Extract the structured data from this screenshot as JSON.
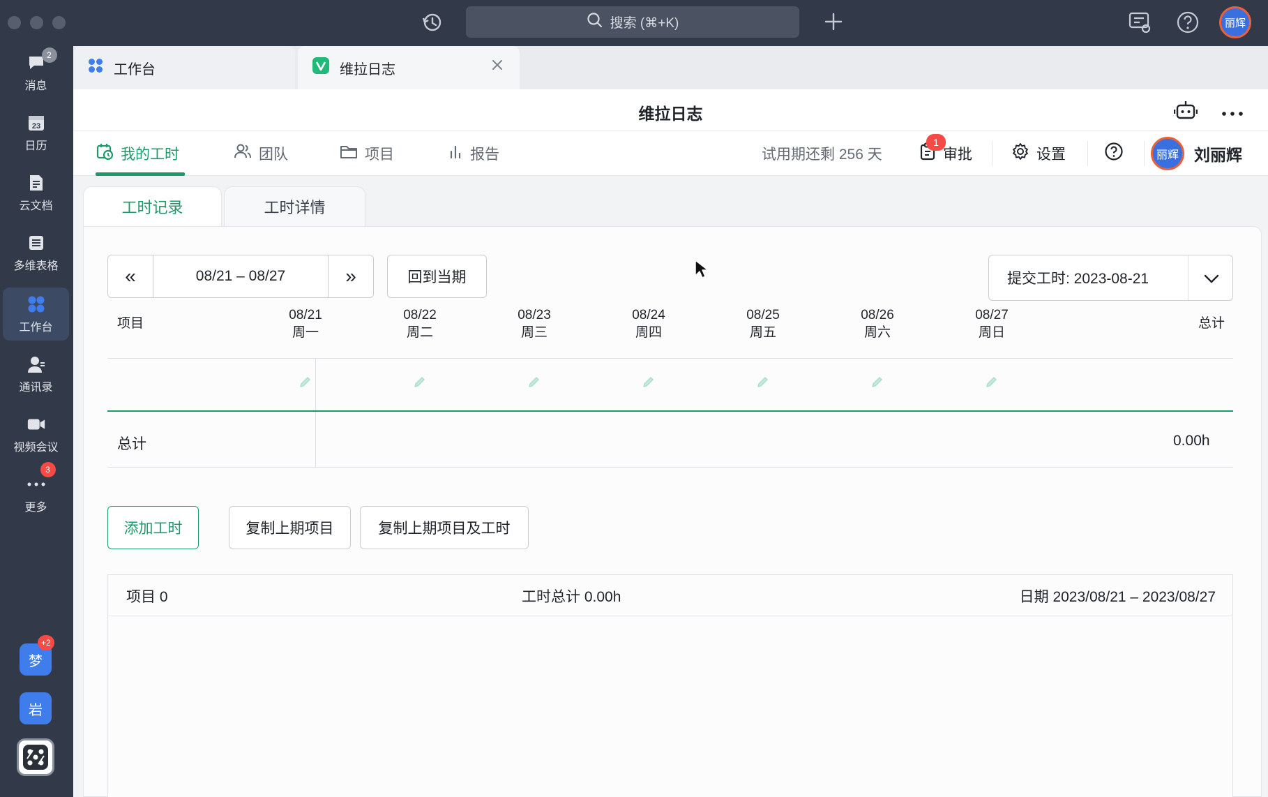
{
  "titlebar": {
    "search_label": "搜索 (⌘+K)",
    "avatar_text": "丽辉"
  },
  "sidebar": {
    "items": [
      {
        "label": "消息",
        "badge": "2"
      },
      {
        "label": "日历",
        "icon_text": "23"
      },
      {
        "label": "云文档"
      },
      {
        "label": "多维表格"
      },
      {
        "label": "工作台"
      },
      {
        "label": "通讯录"
      },
      {
        "label": "视频会议"
      },
      {
        "label": "更多",
        "badge": "3"
      }
    ],
    "shortcuts": [
      {
        "label": "梦",
        "badge": "+2"
      },
      {
        "label": "岩"
      }
    ]
  },
  "tabs": [
    {
      "label": "工作台"
    },
    {
      "label": "维拉日志"
    }
  ],
  "app": {
    "title": "维拉日志",
    "menu": {
      "my_hours": "我的工时",
      "team": "团队",
      "project": "项目",
      "report": "报告",
      "trial": "试用期还剩 256 天",
      "approval": "审批",
      "approval_badge": "1",
      "settings": "设置",
      "user_name": "刘丽辉",
      "user_avatar_text": "丽辉"
    },
    "subtabs": {
      "records": "工时记录",
      "details": "工时详情"
    },
    "date_nav": {
      "prev": "«",
      "range": "08/21 – 08/27",
      "next": "»",
      "back_current": "回到当期",
      "submit": "提交工时: 2023-08-21"
    },
    "table": {
      "project_col": "项目",
      "total_col": "总计",
      "days": [
        {
          "date": "08/21",
          "weekday": "周一"
        },
        {
          "date": "08/22",
          "weekday": "周二"
        },
        {
          "date": "08/23",
          "weekday": "周三"
        },
        {
          "date": "08/24",
          "weekday": "周四"
        },
        {
          "date": "08/25",
          "weekday": "周五"
        },
        {
          "date": "08/26",
          "weekday": "周六"
        },
        {
          "date": "08/27",
          "weekday": "周日"
        }
      ],
      "total_row_label": "总计",
      "total_value": "0.00h"
    },
    "actions": {
      "add_hours": "添加工时",
      "copy_prev_projects": "复制上期项目",
      "copy_prev_projects_hours": "复制上期项目及工时"
    },
    "summary": {
      "projects": "项目 0",
      "total_hours": "工时总计 0.00h",
      "date_range": "日期 2023/08/21 – 2023/08/27"
    }
  },
  "colors": {
    "accent_green": "#1e9a6a",
    "sidebar_bg": "#323a4a",
    "badge_red": "#f54a45"
  }
}
